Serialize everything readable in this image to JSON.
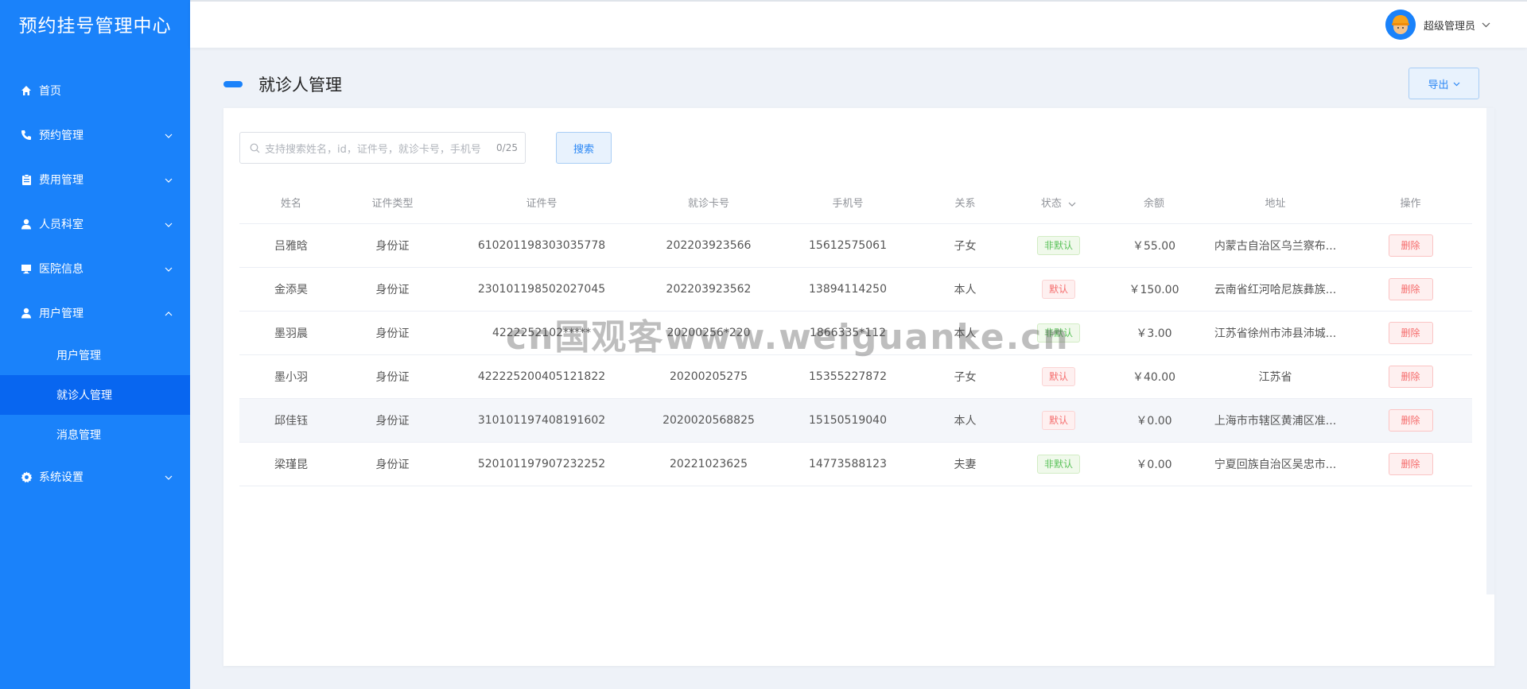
{
  "app": {
    "title": "预约挂号管理中心"
  },
  "sidebar": {
    "items": [
      {
        "label": "首页",
        "icon": "home-icon"
      },
      {
        "label": "预约管理",
        "icon": "phone-icon"
      },
      {
        "label": "费用管理",
        "icon": "clipboard-icon"
      },
      {
        "label": "人员科室",
        "icon": "person-icon"
      },
      {
        "label": "医院信息",
        "icon": "monitor-icon"
      },
      {
        "label": "用户管理",
        "icon": "person-icon",
        "expanded": true
      },
      {
        "label": "系统设置",
        "icon": "gear-icon"
      }
    ],
    "subitems": [
      {
        "label": "用户管理"
      },
      {
        "label": "就诊人管理",
        "active": true
      },
      {
        "label": "消息管理"
      }
    ]
  },
  "header": {
    "username": "超级管理员"
  },
  "page": {
    "title": "就诊人管理",
    "export_label": "导出"
  },
  "search": {
    "placeholder": "支持搜索姓名，id，证件号，就诊卡号，手机号",
    "count": "0/25",
    "button_label": "搜索"
  },
  "table": {
    "columns": [
      "姓名",
      "证件类型",
      "证件号",
      "就诊卡号",
      "手机号",
      "关系",
      "状态",
      "余额",
      "地址",
      "操作"
    ],
    "delete_label": "删除",
    "rows": [
      {
        "name": "吕雅晗",
        "id_type": "身份证",
        "id_no": "610201198303035778",
        "card_no": "202203923566",
        "phone": "15612575061",
        "relation": "子女",
        "status": "非默认",
        "status_color": "green",
        "balance": "￥55.00",
        "address": "内蒙古自治区乌兰察布..."
      },
      {
        "name": "金添昊",
        "id_type": "身份证",
        "id_no": "230101198502027045",
        "card_no": "202203923562",
        "phone": "13894114250",
        "relation": "本人",
        "status": "默认",
        "status_color": "red",
        "balance": "￥150.00",
        "address": "云南省红河哈尼族彝族..."
      },
      {
        "name": "墨羽晨",
        "id_type": "身份证",
        "id_no": "4222252102*****",
        "card_no": "20200256*220",
        "phone": "1866335*112",
        "relation": "本人",
        "status": "非默认",
        "status_color": "green",
        "balance": "￥3.00",
        "address": "江苏省徐州市沛县沛城..."
      },
      {
        "name": "墨小羽",
        "id_type": "身份证",
        "id_no": "422225200405121822",
        "card_no": "20200205275",
        "phone": "15355227872",
        "relation": "子女",
        "status": "默认",
        "status_color": "red",
        "balance": "￥40.00",
        "address": "江苏省"
      },
      {
        "name": "邱佳钰",
        "id_type": "身份证",
        "id_no": "310101197408191602",
        "card_no": "2020020568825",
        "phone": "15150519040",
        "relation": "本人",
        "status": "默认",
        "status_color": "red",
        "balance": "￥0.00",
        "address": "上海市市辖区黄浦区准..."
      },
      {
        "name": "梁瑾昆",
        "id_type": "身份证",
        "id_no": "520101197907232252",
        "card_no": "20221023625",
        "phone": "14773588123",
        "relation": "夫妻",
        "status": "非默认",
        "status_color": "green",
        "balance": "￥0.00",
        "address": "宁夏回族自治区吴忠市..."
      }
    ]
  },
  "watermark": "cn国观客www.weiguanke.cn"
}
